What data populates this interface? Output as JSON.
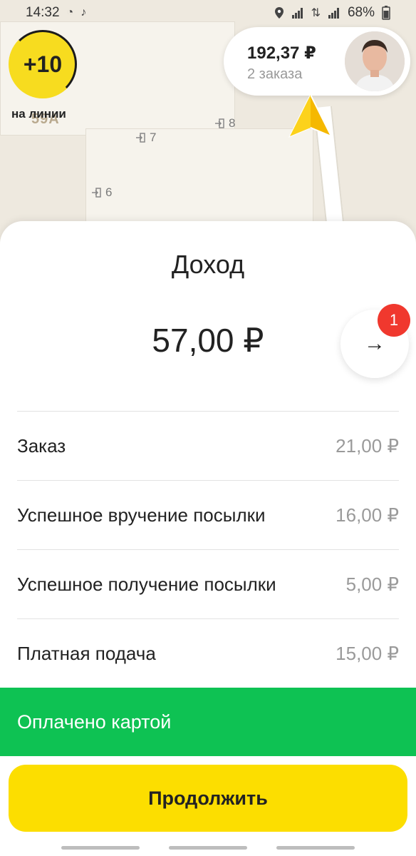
{
  "status_bar": {
    "time": "14:32",
    "battery": "68%"
  },
  "map": {
    "entrances": [
      "7",
      "8",
      "6"
    ],
    "faded_label": "59A"
  },
  "rating": {
    "value": "+10",
    "caption": "на линии"
  },
  "earnings": {
    "amount": "192,37 ₽",
    "orders": "2 заказа"
  },
  "sheet": {
    "title": "Доход",
    "total": "57,00 ₽",
    "detail_badge": "1",
    "detail_arrow": "→",
    "rows": [
      {
        "label": "Заказ",
        "value": "21,00 ₽"
      },
      {
        "label": "Успешное вручение посылки",
        "value": "16,00 ₽"
      },
      {
        "label": "Успешное получение посылки",
        "value": "5,00 ₽"
      },
      {
        "label": "Платная подача",
        "value": "15,00 ₽"
      }
    ],
    "payment_status": "Оплачено картой",
    "continue_label": "Продолжить"
  },
  "colors": {
    "accent_yellow": "#fcde00",
    "paid_green": "#0ec253",
    "badge_red": "#f0382e"
  }
}
